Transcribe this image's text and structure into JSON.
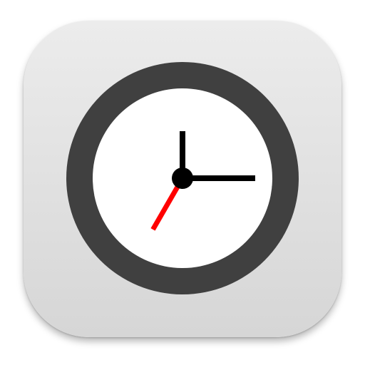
{
  "app_icon": {
    "name": "clock-app-icon",
    "icon": "clock-icon",
    "colors": {
      "tile_top": "#ececec",
      "tile_bottom": "#d6d6d6",
      "bezel": "#404040",
      "face": "#ffffff",
      "hands": "#000000",
      "second_hand": "#ff0000"
    }
  },
  "clock": {
    "hours": 3,
    "minutes": 0,
    "seconds": 35
  }
}
